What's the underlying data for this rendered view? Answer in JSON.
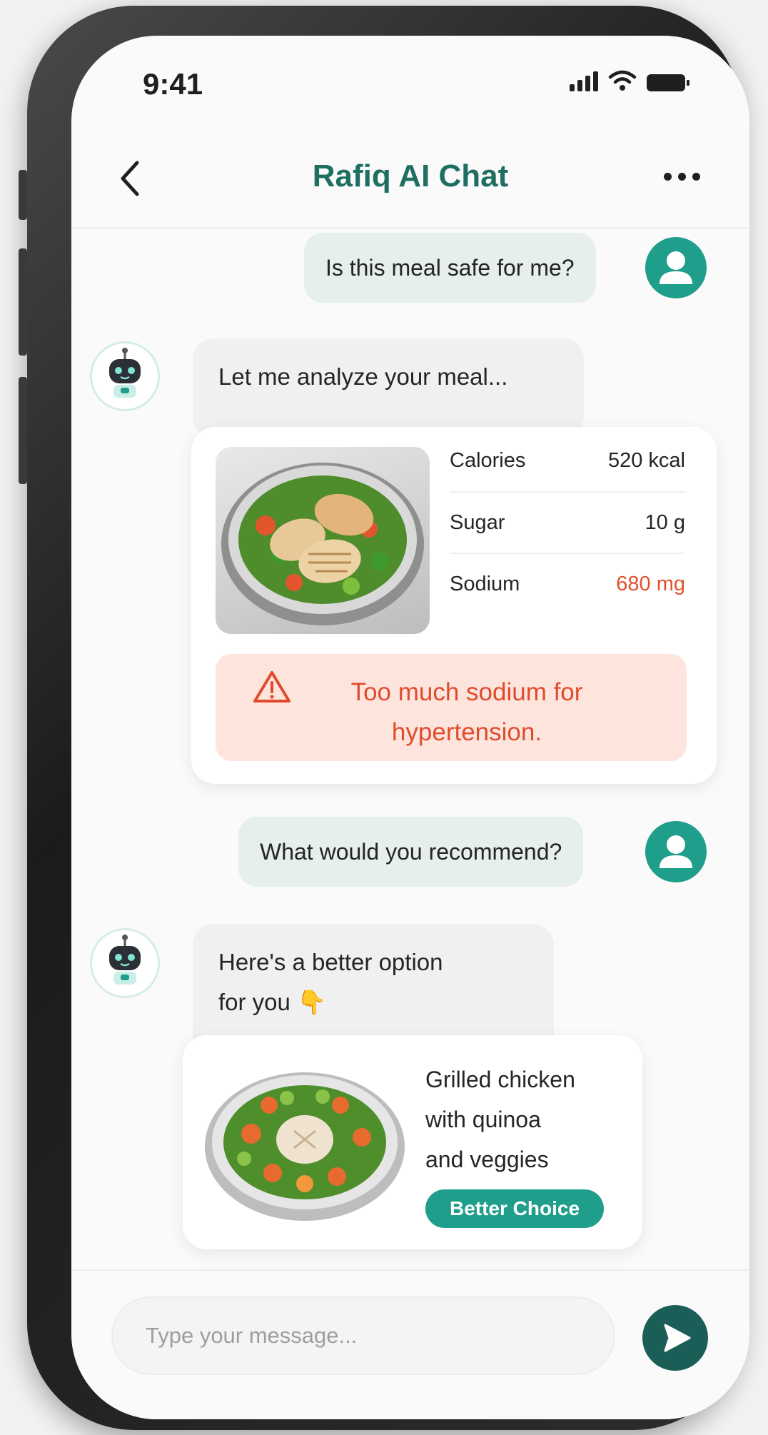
{
  "status_bar": {
    "time": "9:41"
  },
  "header": {
    "title": "Rafiq AI Chat"
  },
  "messages": {
    "user_1": "Is this meal safe for me?",
    "bot_1": "Let me analyze your meal...",
    "user_2": "What would you recommend?",
    "bot_2_line1": "Here's a better option",
    "bot_2_line2": "for you 👇"
  },
  "analysis": {
    "nutrition": [
      {
        "label": "Calories",
        "value": "520 kcal"
      },
      {
        "label": "Sugar",
        "value": "10 g"
      },
      {
        "label": "Sodium",
        "value": "680 mg"
      }
    ],
    "warning_line1": "Too much sodium for",
    "warning_line2": "hypertension."
  },
  "recommendation": {
    "line1": "Grilled chicken",
    "line2": "with quinoa",
    "line3": "and veggies",
    "badge": "Better Choice"
  },
  "input": {
    "placeholder": "Type your message..."
  },
  "colors": {
    "accent": "#1f9e8c",
    "title": "#1e6e62",
    "warning": "#e14b2c",
    "send": "#1b5e58"
  },
  "icons": [
    "back-icon",
    "more-icon",
    "user-icon",
    "robot-icon",
    "warning-icon",
    "send-icon",
    "signal-icon",
    "wifi-icon",
    "battery-icon"
  ]
}
